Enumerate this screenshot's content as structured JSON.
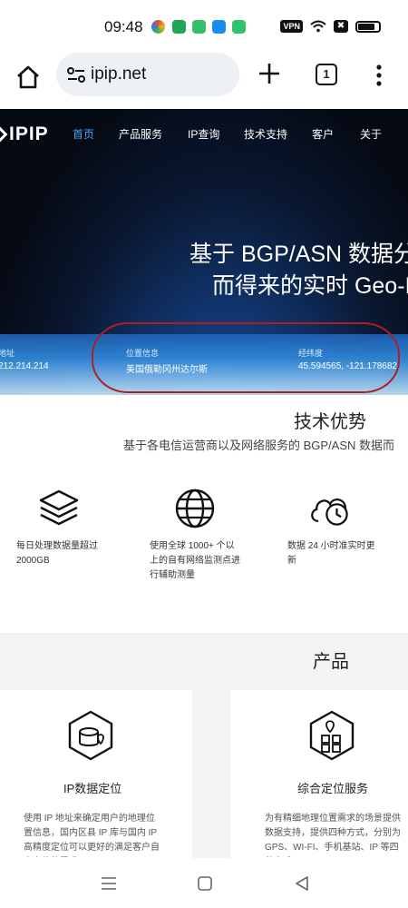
{
  "status_bar": {
    "time": "09:48",
    "vpn": "VPN",
    "box_glyph": "✖",
    "app_icons": [
      "multicolor-app-icon",
      "shield-app-icon",
      "green-app-icon",
      "blue-chat-app-icon",
      "green-a-app-icon"
    ]
  },
  "browser": {
    "url": "ipip.net",
    "tab_count": "1"
  },
  "site": {
    "logo": "IPIP",
    "nav": [
      "首页",
      "产品服务",
      "IP查询",
      "技术支持",
      "客户",
      "关于"
    ],
    "hero_line1": "基于 BGP/ASN 数据分",
    "hero_line2": "而得来的实时 Geo-I",
    "info": [
      {
        "label": "地址",
        "value": "212.214.214"
      },
      {
        "label": "位置信息",
        "value": "美国俄勒冈州达尔斯"
      },
      {
        "label": "经纬度",
        "value": "45.594565, -121.178682"
      }
    ],
    "advantages_title": "技术优势",
    "advantages_sub": "基于各电信运营商以及网络服务的 BGP/ASN 数据而",
    "features": [
      {
        "icon": "layers-icon",
        "text": "每日处理数据量超过 2000GB"
      },
      {
        "icon": "globe-icon",
        "text": "使用全球 1000+ 个以上的自有网络监测点进行辅助测量"
      },
      {
        "icon": "cloud-clock-icon",
        "text": "数据 24 小时准实时更新"
      }
    ],
    "products_title": "产品",
    "products": [
      {
        "icon": "ip-location-icon",
        "title": "IP数据定位",
        "desc": "使用 IP 地址来确定用户的地理位置信息，国内区县 IP 库与国内 IP 高精度定位可以更好的满足客户自身定位的需求"
      },
      {
        "icon": "composite-location-icon",
        "title": "综合定位服务",
        "desc": "为有精细地理位置需求的场景提供数据支持，提供四种方式，分别为 GPS、WI-FI、手机基站、IP 等四种方式"
      }
    ]
  },
  "colors": {
    "nav_active": "#4aa3ff",
    "annotation": "#b01e23",
    "hero_dark": "#050912",
    "hero_blue": "#2f86d6"
  }
}
